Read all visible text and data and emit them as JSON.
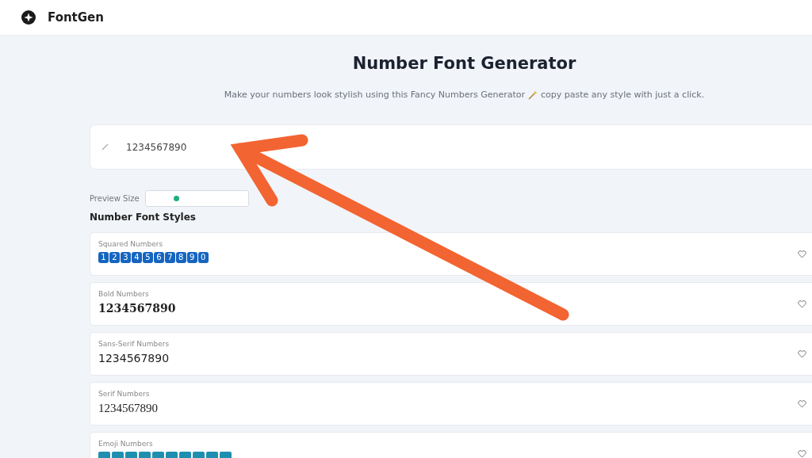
{
  "header": {
    "brand": "FontGen"
  },
  "title": "Number Font Generator",
  "subtitle": {
    "before": "Make your numbers look stylish using this Fancy Numbers Generator",
    "after": "copy paste any style with just a click."
  },
  "input": {
    "value": "1234567890"
  },
  "preview_size": {
    "label": "Preview Size",
    "level": 0.3
  },
  "styles_heading": "Number Font Styles",
  "styles": [
    {
      "kind": "squared",
      "label": "Squared Numbers",
      "sample": "1 2 3 4 5 6 7 8 9 0",
      "favorite": false
    },
    {
      "kind": "bold",
      "label": "Bold Numbers",
      "sample": "1234567890",
      "favorite": false
    },
    {
      "kind": "sans",
      "label": "Sans-Serif Numbers",
      "sample": "1234567890",
      "favorite": false
    },
    {
      "kind": "serif",
      "label": "Serif Numbers",
      "sample": "1234567890",
      "favorite": false
    },
    {
      "kind": "emoji",
      "label": "Emoji Numbers",
      "favorite": false
    }
  ]
}
